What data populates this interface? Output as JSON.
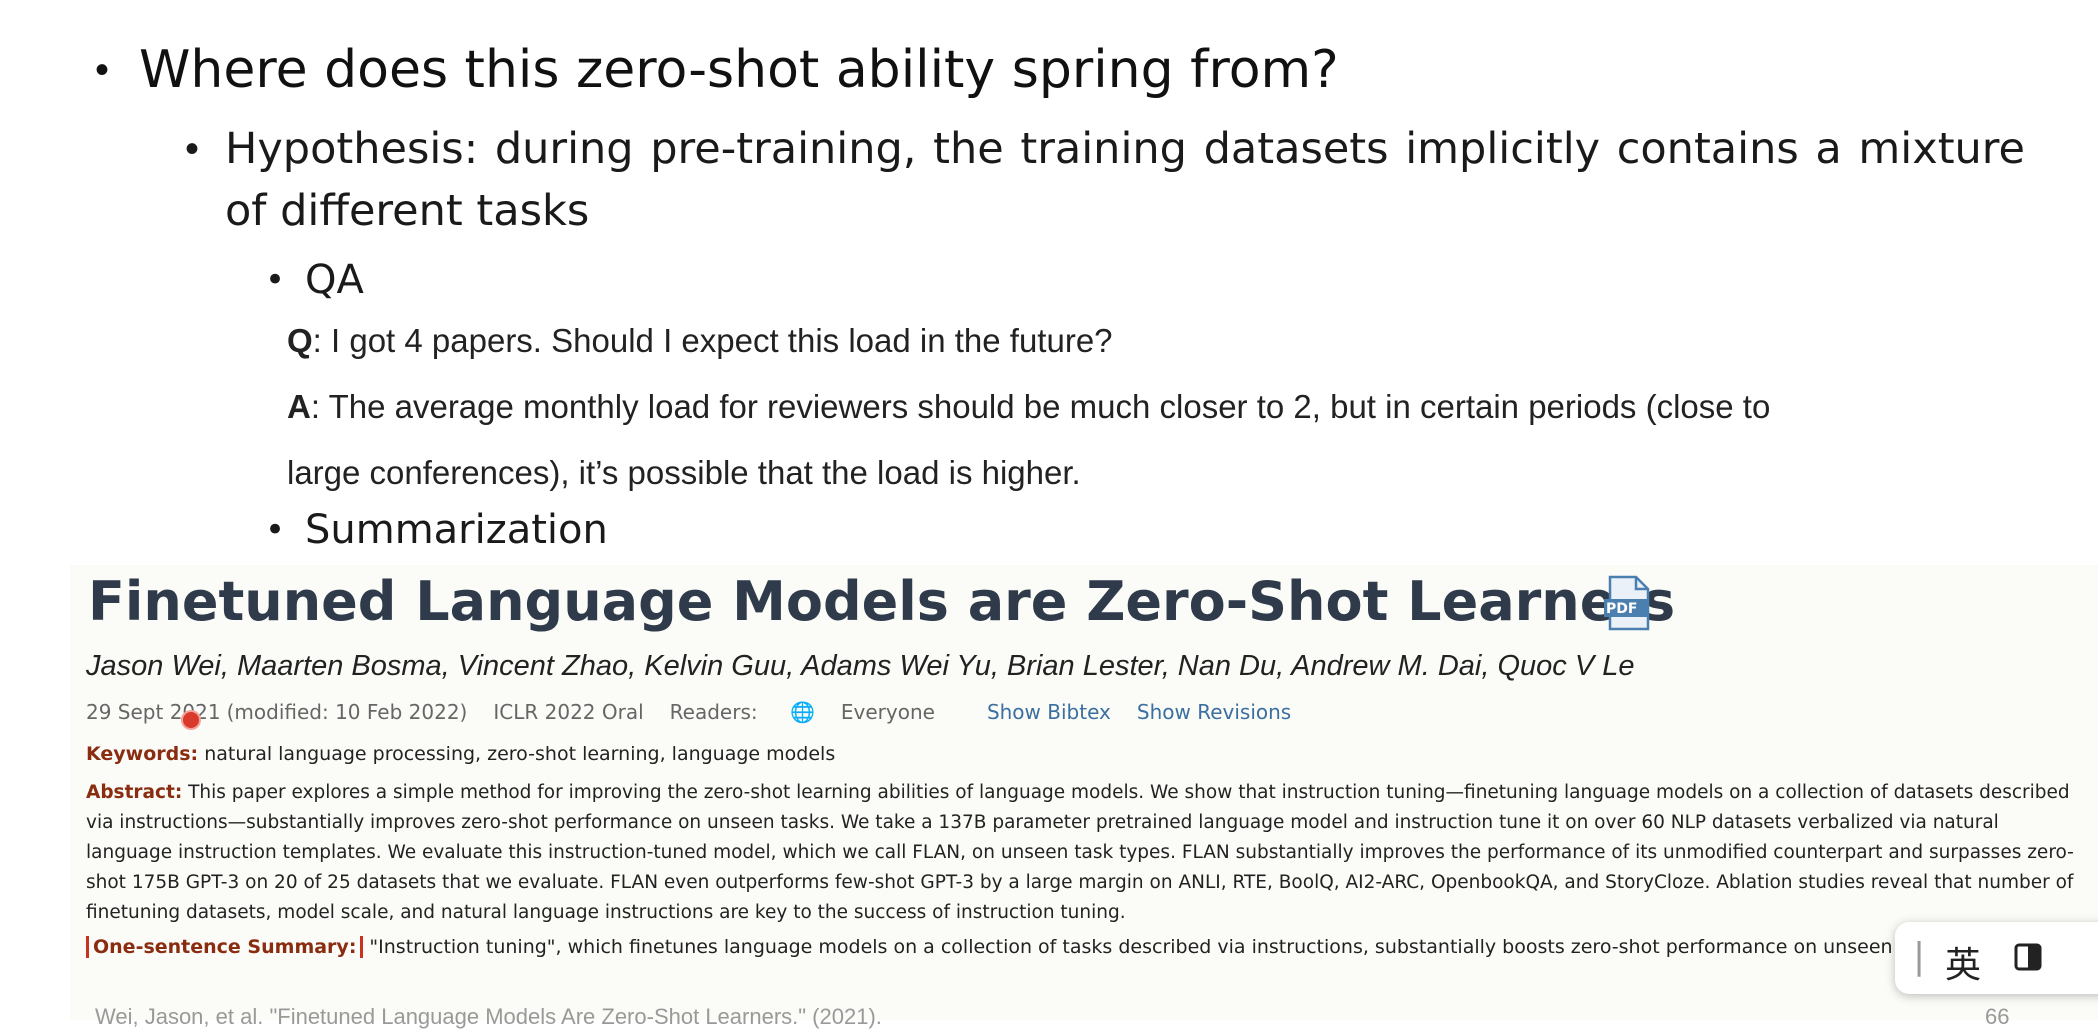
{
  "slide": {
    "bullet1": "Where does this zero-shot ability spring from?",
    "bullet2": "Hypothesis: during pre-training, the training datasets implicitly contains a mixture of different tasks",
    "bullet3_qa": "QA",
    "q_label": "Q",
    "q_text": ": I got 4 papers. Should I expect this load in the future?",
    "a_label": "A",
    "a_text_line1": ": The average monthly load for reviewers should be much closer to 2, but in certain periods (close to",
    "a_text_line2": "large conferences), it’s possible that the load is higher.",
    "bullet3_sum": "Summarization",
    "footer": "Wei, Jason, et al. \"Finetuned Language Models Are Zero-Shot Learners.\" (2021).",
    "page_number": "66"
  },
  "paper": {
    "title": "Finetuned Language Models are Zero-Shot Learners",
    "pdf_icon_label": "PDF",
    "authors": "Jason Wei, Maarten Bosma, Vincent Zhao, Kelvin Guu, Adams Wei Yu, Brian Lester, Nan Du, Andrew M. Dai, Quoc V Le",
    "date": "29 Sept 2021",
    "modified": "(modified: 10 Feb 2022)",
    "venue": "ICLR 2022 Oral",
    "readers_label": "Readers:",
    "readers_value": "Everyone",
    "show_bibtex": "Show Bibtex",
    "show_revisions": "Show Revisions",
    "keywords_label": "Keywords:",
    "keywords": "natural language processing, zero-shot learning, language models",
    "abstract_label": "Abstract:",
    "abstract": "This paper explores a simple method for improving the zero-shot learning abilities of language models. We show that instruction tuning—finetuning language models on a collection of datasets described via instructions—substantially improves zero-shot performance on unseen tasks. We take a 137B parameter pretrained language model and instruction tune it on over 60 NLP datasets verbalized via natural language instruction templates. We evaluate this instruction-tuned model, which we call FLAN, on unseen task types. FLAN substantially improves the performance of its unmodified counterpart and surpasses zero-shot 175B GPT-3 on 20 of 25 datasets that we evaluate. FLAN even outperforms few-shot GPT-3 by a large margin on ANLI, RTE, BoolQ, AI2-ARC, OpenbookQA, and StoryCloze. Ablation studies reveal that number of finetuning datasets, model scale, and natural language instructions are key to the success of instruction tuning.",
    "summary_label": "One-sentence Summary:",
    "summary": "\"Instruction tuning\", which finetunes language models on a collection of tasks described via instructions, substantially boosts zero-shot performance on unseen tasks."
  },
  "ime_toolbar": {
    "lang": "英"
  },
  "colors": {
    "title": "#2f3a4a",
    "label": "#8a2c10",
    "link": "#3a6fa0",
    "highlight_box": "#c8331f"
  }
}
